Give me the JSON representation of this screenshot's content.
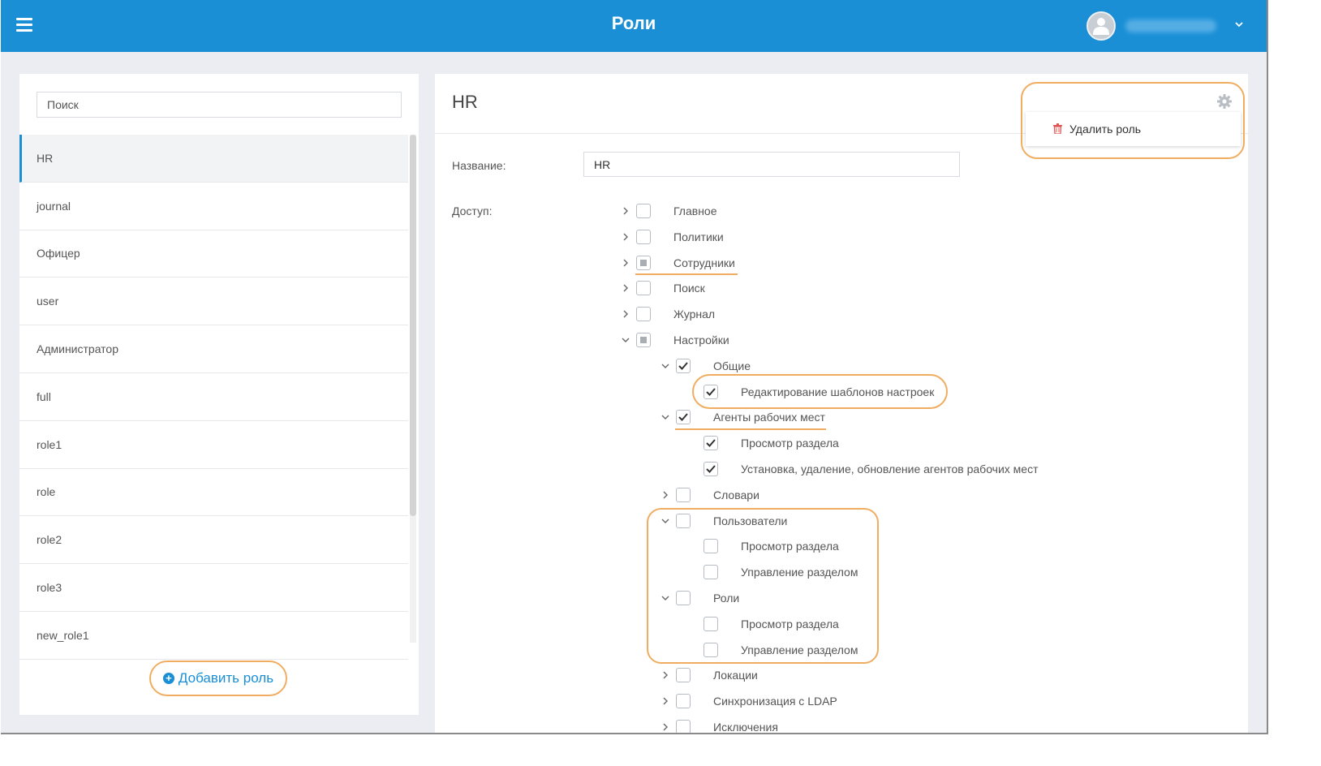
{
  "header": {
    "title": "Роли"
  },
  "sidebar": {
    "search_placeholder": "Поиск",
    "roles": [
      "HR",
      "journal",
      "Офицер",
      "user",
      "Администратор",
      "full",
      "role1",
      "role",
      "role2",
      "role3",
      "new_role1"
    ],
    "active_role": "HR",
    "add_role_label": "Добавить роль"
  },
  "main": {
    "title": "HR",
    "name_label": "Название:",
    "name_value": "HR",
    "access_label": "Доступ:",
    "delete_role_label": "Удалить роль",
    "tree": [
      {
        "label": "Главное",
        "level": 0,
        "expander": "collapsed",
        "state": "unchecked"
      },
      {
        "label": "Политики",
        "level": 0,
        "expander": "collapsed",
        "state": "unchecked"
      },
      {
        "label": "Сотрудники",
        "level": 0,
        "expander": "collapsed",
        "state": "partial"
      },
      {
        "label": "Поиск",
        "level": 0,
        "expander": "collapsed",
        "state": "unchecked"
      },
      {
        "label": "Журнал",
        "level": 0,
        "expander": "collapsed",
        "state": "unchecked"
      },
      {
        "label": "Настройки",
        "level": 0,
        "expander": "expanded",
        "state": "partial"
      },
      {
        "label": "Общие",
        "level": 1,
        "expander": "expanded",
        "state": "checked"
      },
      {
        "label": "Редактирование шаблонов настроек",
        "level": 2,
        "expander": "none",
        "state": "checked"
      },
      {
        "label": "Агенты рабочих мест",
        "level": 1,
        "expander": "expanded",
        "state": "checked"
      },
      {
        "label": "Просмотр раздела",
        "level": 2,
        "expander": "none",
        "state": "checked"
      },
      {
        "label": "Установка, удаление, обновление агентов рабочих мест",
        "level": 2,
        "expander": "none",
        "state": "checked"
      },
      {
        "label": "Словари",
        "level": 1,
        "expander": "collapsed",
        "state": "unchecked"
      },
      {
        "label": "Пользователи",
        "level": 1,
        "expander": "expanded",
        "state": "unchecked"
      },
      {
        "label": "Просмотр раздела",
        "level": 2,
        "expander": "none",
        "state": "unchecked"
      },
      {
        "label": "Управление разделом",
        "level": 2,
        "expander": "none",
        "state": "unchecked"
      },
      {
        "label": "Роли",
        "level": 1,
        "expander": "expanded",
        "state": "unchecked"
      },
      {
        "label": "Просмотр раздела",
        "level": 2,
        "expander": "none",
        "state": "unchecked"
      },
      {
        "label": "Управление разделом",
        "level": 2,
        "expander": "none",
        "state": "unchecked"
      },
      {
        "label": "Локации",
        "level": 1,
        "expander": "collapsed",
        "state": "unchecked"
      },
      {
        "label": "Синхронизация с LDAP",
        "level": 1,
        "expander": "collapsed",
        "state": "unchecked"
      },
      {
        "label": "Исключения",
        "level": 1,
        "expander": "collapsed",
        "state": "unchecked"
      }
    ]
  },
  "colors": {
    "brand": "#1a8fd6",
    "highlight": "#f0ad61",
    "delete_icon": "#e05454"
  }
}
